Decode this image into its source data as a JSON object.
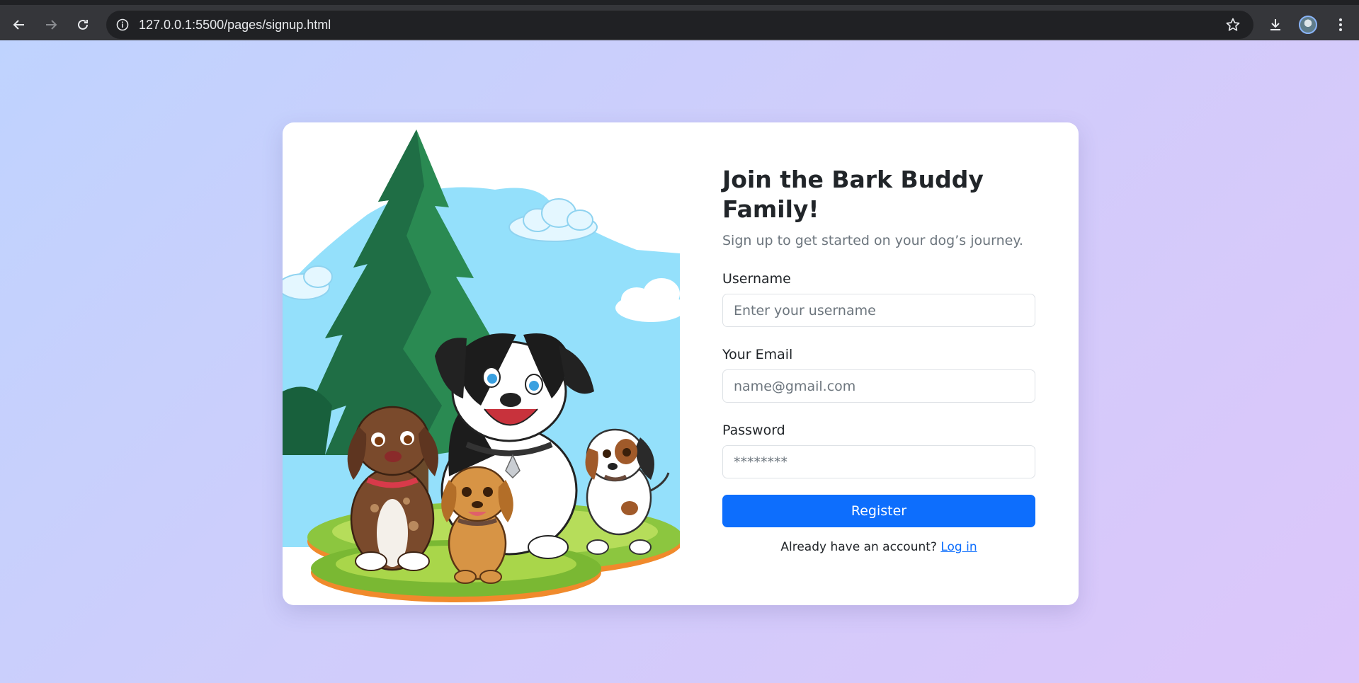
{
  "browser": {
    "url": "127.0.0.1:5500/pages/signup.html",
    "icons": {
      "back": "arrow-left-icon",
      "forward": "arrow-right-icon",
      "reload": "reload-icon",
      "site_info": "info-icon",
      "bookmark": "star-icon",
      "downloads": "download-icon",
      "profile": "avatar",
      "menu": "kebab-menu-icon"
    }
  },
  "signup": {
    "title": "Join the Bark Buddy Family!",
    "subtitle": "Sign up to get started on your dog’s journey.",
    "username": {
      "label": "Username",
      "placeholder": "Enter your username",
      "value": ""
    },
    "email": {
      "label": "Your Email",
      "placeholder": "name@gmail.com",
      "value": ""
    },
    "password": {
      "label": "Password",
      "placeholder": "********",
      "value": ""
    },
    "register_label": "Register",
    "login_prompt": "Already have an account?",
    "login_link": "Log in"
  },
  "colors": {
    "primary": "#0d6efd",
    "background_start": "#bfd3fe",
    "background_end": "#dcc6fa",
    "chrome": "#35363a"
  }
}
